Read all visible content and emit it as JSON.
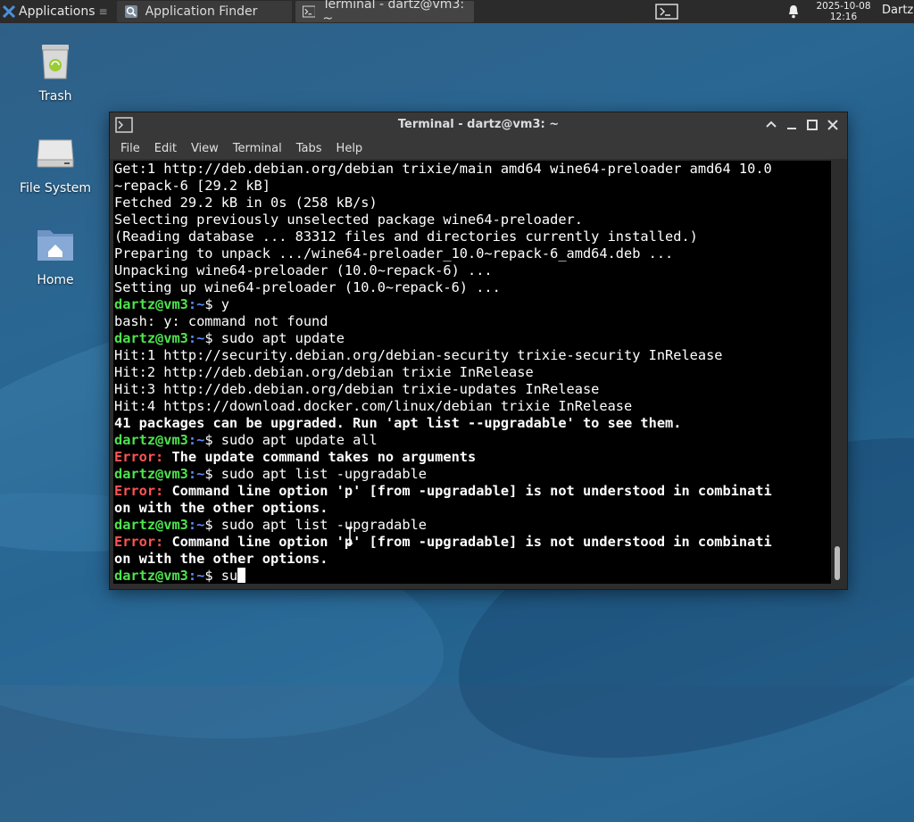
{
  "panel": {
    "applications_label": "Applications",
    "tasks": [
      {
        "label": "Application Finder",
        "icon": "search-icon"
      },
      {
        "label": "Terminal - dartz@vm3: ~",
        "icon": "terminal-icon"
      }
    ],
    "clock_date": "2025-10-08",
    "clock_time": "12:16",
    "user": "Dartz"
  },
  "desktop": {
    "icons": [
      {
        "label": "Trash",
        "icon": "trash-icon"
      },
      {
        "label": "File System",
        "icon": "drive-icon"
      },
      {
        "label": "Home",
        "icon": "home-folder-icon"
      }
    ]
  },
  "window": {
    "title": "Terminal - dartz@vm3: ~",
    "menu": [
      "File",
      "Edit",
      "View",
      "Terminal",
      "Tabs",
      "Help"
    ]
  },
  "terminal": {
    "user_host": "dartz@vm3",
    "path": "~",
    "prompt_symbol": "$",
    "error_label": "Error:",
    "lines": {
      "l0": "Get:1 http://deb.debian.org/debian trixie/main amd64 wine64-preloader amd64 10.0",
      "l1": "~repack-6 [29.2 kB]",
      "l2": "Fetched 29.2 kB in 0s (258 kB/s)",
      "l3": "Selecting previously unselected package wine64-preloader.",
      "l4": "(Reading database ... 83312 files and directories currently installed.)",
      "l5": "Preparing to unpack .../wine64-preloader_10.0~repack-6_amd64.deb ...",
      "l6": "Unpacking wine64-preloader (10.0~repack-6) ...",
      "l7": "Setting up wine64-preloader (10.0~repack-6) ...",
      "cmd1": " y",
      "l9": "bash: y: command not found",
      "cmd2": " sudo apt update",
      "l11": "Hit:1 http://security.debian.org/debian-security trixie-security InRelease",
      "l12": "Hit:2 http://deb.debian.org/debian trixie InRelease",
      "l13": "Hit:3 http://deb.debian.org/debian trixie-updates InRelease",
      "l14": "Hit:4 https://download.docker.com/linux/debian trixie InRelease",
      "l15": "41 packages can be upgraded. Run 'apt list --upgradable' to see them.",
      "cmd3": " sudo apt update all",
      "err1": " The update command takes no arguments",
      "cmd4": " sudo apt list -upgradable",
      "err2": " Command line option 'p' [from -upgradable] is not understood in combinati",
      "err2b": "on with the other options.",
      "cmd5": " sudo apt list -upgradable",
      "err3": " Command line option 'p' [from -upgradable] is not understood in combinati",
      "err3b": "on with the other options.",
      "cmd6": " su"
    }
  }
}
